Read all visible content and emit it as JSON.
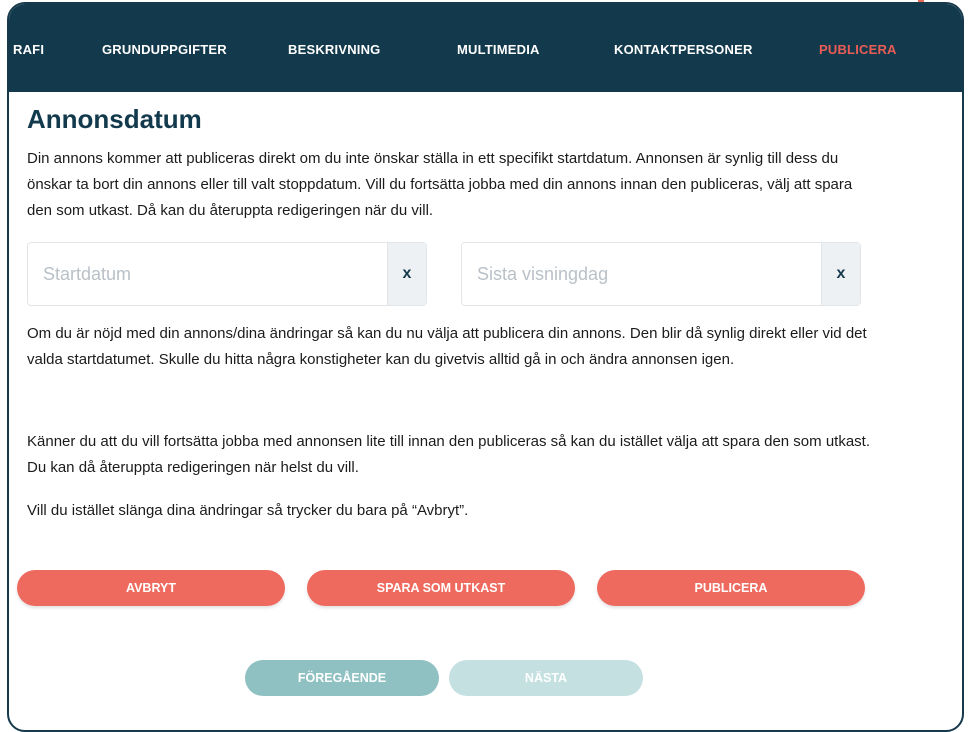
{
  "nav": {
    "items": [
      {
        "label": "RAFI"
      },
      {
        "label": "GRUNDUPPGIFTER"
      },
      {
        "label": "BESKRIVNING"
      },
      {
        "label": "MULTIMEDIA"
      },
      {
        "label": "KONTAKTPERSONER"
      },
      {
        "label": "PUBLICERA",
        "active": true
      }
    ]
  },
  "section": {
    "title": "Annonsdatum",
    "intro": "Din annons kommer att publiceras direkt om du inte önskar ställa in ett specifikt startdatum. Annonsen är synlig till dess du önskar ta bort din annons eller till valt stoppdatum. Vill du fortsätta jobba med din annons innan den publiceras, välj att spara den som utkast. Då kan du återuppta redigeringen när du vill."
  },
  "dates": {
    "start": {
      "placeholder": "Startdatum",
      "value": "",
      "clear_label": "x"
    },
    "end": {
      "placeholder": "Sista visningdag",
      "value": "",
      "clear_label": "x"
    }
  },
  "info": {
    "p1": "Om du är nöjd med din annons/dina ändringar så kan du nu välja att publicera din annons. Den blir då synlig direkt eller vid det valda startdatumet. Skulle du hitta några konstigheter kan du givetvis alltid gå in och ändra annonsen igen.",
    "p2": "Känner du att du vill fortsätta jobba med annonsen lite till innan den publiceras så kan du istället välja att spara den som utkast. Du kan då återuppta redigeringen när helst du vill.",
    "p3": "Vill du istället slänga dina ändringar så trycker du bara på “Avbryt”."
  },
  "actions": {
    "cancel": "AVBRYT",
    "save_draft": "SPARA SOM UTKAST",
    "publish": "PUBLICERA"
  },
  "steps": {
    "previous": "FÖREGÅENDE",
    "next": "NÄSTA"
  },
  "colors": {
    "navy": "#133a4c",
    "accent": "#ef6a5e",
    "teal": "#8fc0c2",
    "teal_light": "#c4e0e1"
  }
}
